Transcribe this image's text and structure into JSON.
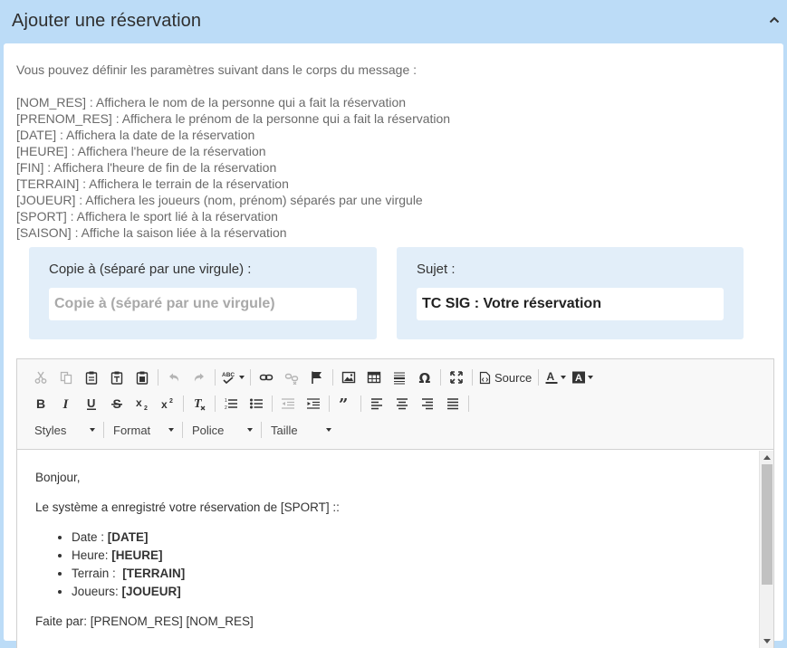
{
  "header": {
    "title": "Ajouter une réservation"
  },
  "intro": {
    "heading": "Vous pouvez définir les paramètres suivant dans le corps du message :",
    "params": [
      "[NOM_RES] : Affichera le nom de la personne qui a fait la réservation",
      "[PRENOM_RES] : Affichera le prénom de la personne qui a fait la réservation",
      "[DATE] : Affichera la date de la réservation",
      "[HEURE] : Affichera l'heure de la réservation",
      "[FIN] : Affichera l'heure de fin de la réservation",
      "[TERRAIN] : Affichera le terrain de la réservation",
      "[JOUEUR] : Affichera les joueurs (nom, prénom) séparés par une virgule",
      "[SPORT] : Affichera le sport lié à la réservation",
      "[SAISON] : Affiche la saison liée à la réservation"
    ]
  },
  "copy": {
    "label": "Copie à (séparé par une virgule) :",
    "placeholder": "Copie à (séparé par une virgule)",
    "value": ""
  },
  "subject": {
    "label": "Sujet :",
    "value": "TC SIG : Votre réservation"
  },
  "toolbar": {
    "source_label": "Source",
    "styles_label": "Styles",
    "format_label": "Format",
    "font_label": "Police",
    "size_label": "Taille"
  },
  "body": {
    "greeting": "Bonjour,",
    "intro_line": "Le système a enregistré votre réservation de [SPORT] ::",
    "items": [
      {
        "label": "Date : ",
        "value": "[DATE]"
      },
      {
        "label": "Heure: ",
        "value": "[HEURE]"
      },
      {
        "label": "Terrain :  ",
        "value": "[TERRAIN]"
      },
      {
        "label": "Joueurs: ",
        "value": "[JOUEUR]"
      }
    ],
    "signature": "Faite par: [PRENOM_RES] [NOM_RES]"
  }
}
